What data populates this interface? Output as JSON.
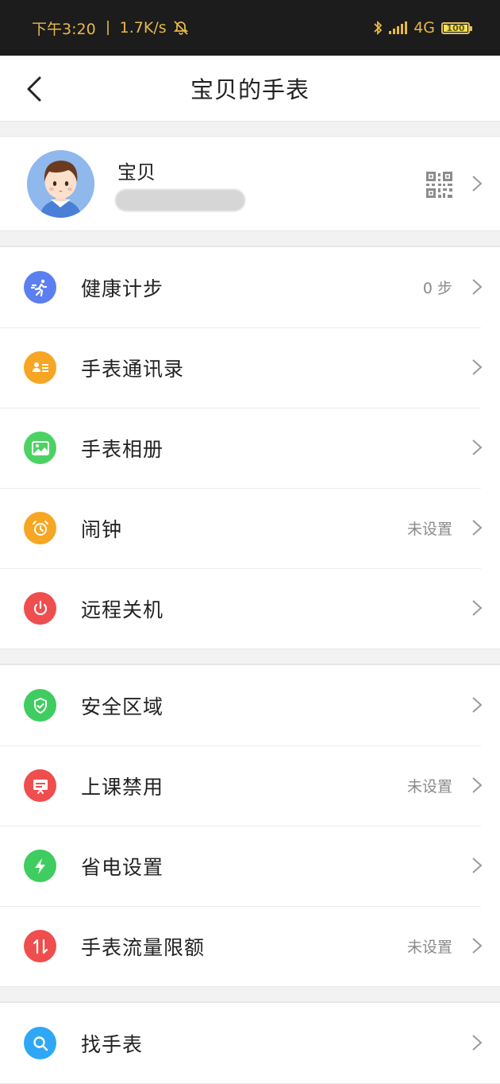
{
  "status_bar": {
    "time": "下午3:20",
    "net_speed": "1.7K/s",
    "network": "4G",
    "battery_level": "100"
  },
  "nav": {
    "title": "宝贝的手表"
  },
  "profile": {
    "name": "宝贝"
  },
  "colors": {
    "statusbar_bg": "#1c1c1c",
    "statusbar_text": "#e8b84a",
    "health": "#5b7ff0",
    "contacts": "#f6a623",
    "album": "#4cd263",
    "alarm": "#f6a623",
    "shutdown": "#ef4e4e",
    "safe_zone": "#3fcc60",
    "class_ban": "#ef4e4e",
    "power_save": "#3fcc60",
    "traffic": "#ef4e4e",
    "find_watch": "#2ea8f5"
  },
  "menu_groups": [
    {
      "items": [
        {
          "label": "健康计步",
          "value": "0 步",
          "icon": "running-icon"
        },
        {
          "label": "手表通讯录",
          "value": "",
          "icon": "contacts-icon"
        },
        {
          "label": "手表相册",
          "value": "",
          "icon": "photo-icon"
        },
        {
          "label": "闹钟",
          "value": "未设置",
          "icon": "alarm-clock-icon"
        },
        {
          "label": "远程关机",
          "value": "",
          "icon": "power-icon"
        }
      ]
    },
    {
      "items": [
        {
          "label": "安全区域",
          "value": "",
          "icon": "shield-check-icon"
        },
        {
          "label": "上课禁用",
          "value": "未设置",
          "icon": "classroom-icon"
        },
        {
          "label": "省电设置",
          "value": "",
          "icon": "lightning-icon"
        },
        {
          "label": "手表流量限额",
          "value": "未设置",
          "icon": "data-traffic-icon"
        }
      ]
    },
    {
      "items": [
        {
          "label": "找手表",
          "value": "",
          "icon": "search-icon"
        }
      ]
    }
  ]
}
